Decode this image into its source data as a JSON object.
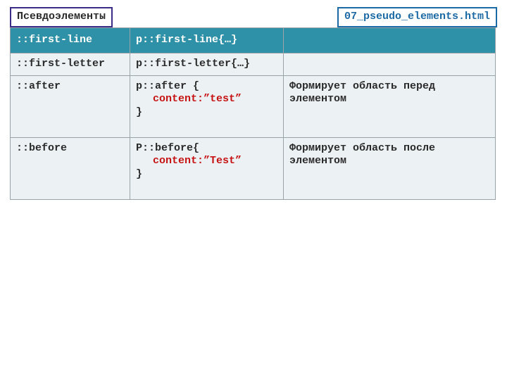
{
  "header": {
    "title": "Псевдоэлементы",
    "filename": "07_pseudo_elements.html"
  },
  "table": {
    "head": {
      "c1": "::first-line",
      "c2": "p::first-line{…}",
      "c3": ""
    },
    "rows": [
      {
        "c1": "::first-letter",
        "c2_line1": "p::first-letter{…}",
        "c2_line2": "",
        "c2_line3": "",
        "c3": "",
        "tall": false
      },
      {
        "c1": "::after",
        "c2_line1": "p::after {",
        "c2_line2": "content:”test”",
        "c2_line3": "}",
        "c3": "Формирует область перед элементом",
        "tall": true
      },
      {
        "c1": "::before",
        "c2_line1": "P::before{",
        "c2_line2": "content:”Test”",
        "c2_line3": "}",
        "c3": "Формирует область после элементом",
        "tall": true
      }
    ]
  }
}
